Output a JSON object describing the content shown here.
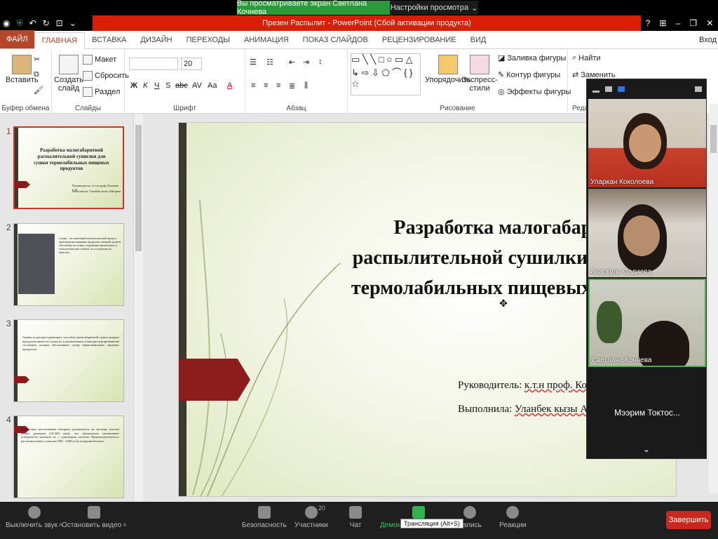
{
  "share_bar": {
    "viewing_text": "Вы просматриваете экран Светлана Кочнева",
    "view_settings": "Настройки просмотра"
  },
  "titlebar": {
    "title": "Презен Распылит - PowerPoint (Сбой активации продукта)",
    "help": "?",
    "restore_icon": "restore-icon",
    "close": "✕"
  },
  "ribbon_tabs": [
    "ФАЙЛ",
    "ГЛАВНАЯ",
    "ВСТАВКА",
    "ДИЗАЙН",
    "ПЕРЕХОДЫ",
    "АНИМАЦИЯ",
    "ПОКАЗ СЛАЙДОВ",
    "РЕЦЕНЗИРОВАНИЕ",
    "ВИД"
  ],
  "login": "Вход",
  "ribbon": {
    "paste": "Вставить",
    "clipboard_label": "Буфер обмена",
    "new_slide": "Создать слайд",
    "layout": "Макет",
    "reset": "Сбросить",
    "section": "Раздел",
    "slides_label": "Слайды",
    "font_size": "20",
    "font_label": "Шрифт",
    "paragraph_label": "Абзац",
    "arrange": "Упорядочить",
    "quick_styles": "Экспресс-стили",
    "shape_fill": "Заливка фигуры",
    "shape_outline": "Контур фигуры",
    "shape_effects": "Эффекты фигуры",
    "drawing_label": "Рисование",
    "find": "Найти",
    "replace": "Заменить",
    "editing_label": "Реда"
  },
  "thumbnails": [
    {
      "num": "1",
      "title": "Разработка малогабаритной распылительной сушилки для сушки термолабильных пищевых продуктов",
      "sub1": "Руководитель: к.т.н проф. Кочнева С.В.",
      "sub2": "Выполнила: Уланбек кызы Айгерим"
    },
    {
      "num": "2",
      "text": "Сушка - это конечный технологический процесс производства пищевых продуктов, который должен обеспечить не только сохранение питательных и технологических свойств, но и улучшить их качество."
    },
    {
      "num": "3",
      "text": "Одним из распространенных способов малогабаритной сушки жидких продуктов является сушка их в распыленном (тонкодиспергированном) состоянии, которая обеспечивает сушку термолабильных пищевых продуктов."
    },
    {
      "num": "4",
      "text": "При сушке распылением материал распыляется на частицы (капли) малых размеров (10-300 мкм), что значительно увеличивает поверхность контакта их с сушильным агентом. Производительность распылительных сушилок (500 - 1000 кг/ч) испаренной влаги."
    }
  ],
  "slide": {
    "title_line1": "Разработка малогабаритной",
    "title_line2": "распылительной  сушилки для сушки",
    "title_line3": "термолабильных пищевых продуктов",
    "supervisor_prefix": "Руководитель: ",
    "supervisor_name": "к.т.н проф. Ко",
    "author_prefix": "Выполнила: ",
    "author_name": "Уланбек кызы А"
  },
  "participants": [
    {
      "name": "Уларкан Коколоева"
    },
    {
      "name": "Анаркуль Садиева"
    },
    {
      "name": "Светлана Кочнева"
    },
    {
      "name": "Мээрим  Токтос..."
    }
  ],
  "zoom_toolbar": {
    "mute": "Выключить звук",
    "video": "Остановить видео",
    "security": "Безопасность",
    "participants": "Участники",
    "participants_count": "20",
    "chat": "Чат",
    "share": "Демонстрация экрана",
    "record": "Запись",
    "reactions": "Реакции",
    "end": "Завершить",
    "tooltip": "Трансляция (Alt+S)"
  },
  "colors": {
    "ppt_accent": "#b7472a",
    "title_red": "#d81e05",
    "zoom_green": "#2b9a3a",
    "end_red": "#c9281f"
  }
}
